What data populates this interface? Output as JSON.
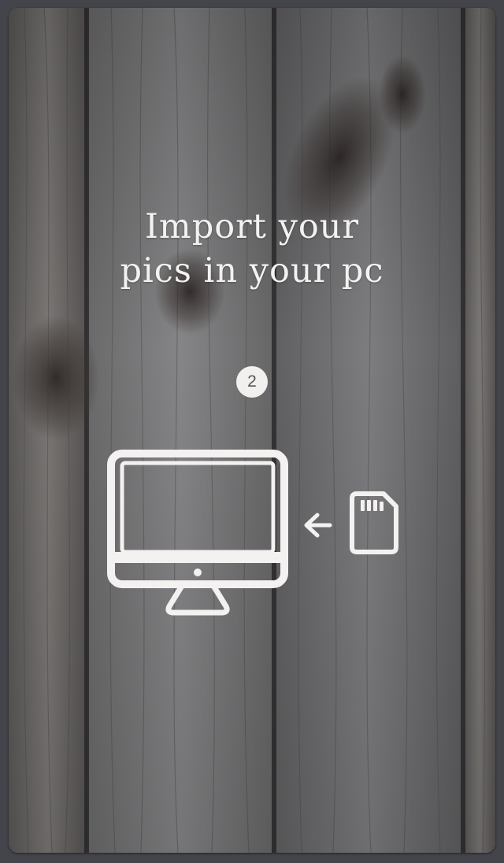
{
  "onboarding": {
    "title_line1": "Import your",
    "title_line2": "pics in your pc",
    "step_number": "2"
  },
  "icons": {
    "computer": "desktop-monitor-icon",
    "arrow": "arrow-left-icon",
    "memory_card": "sd-card-icon"
  },
  "colors": {
    "text": "#f4f1f1",
    "background": "#44454b",
    "badge_text": "#555555"
  }
}
